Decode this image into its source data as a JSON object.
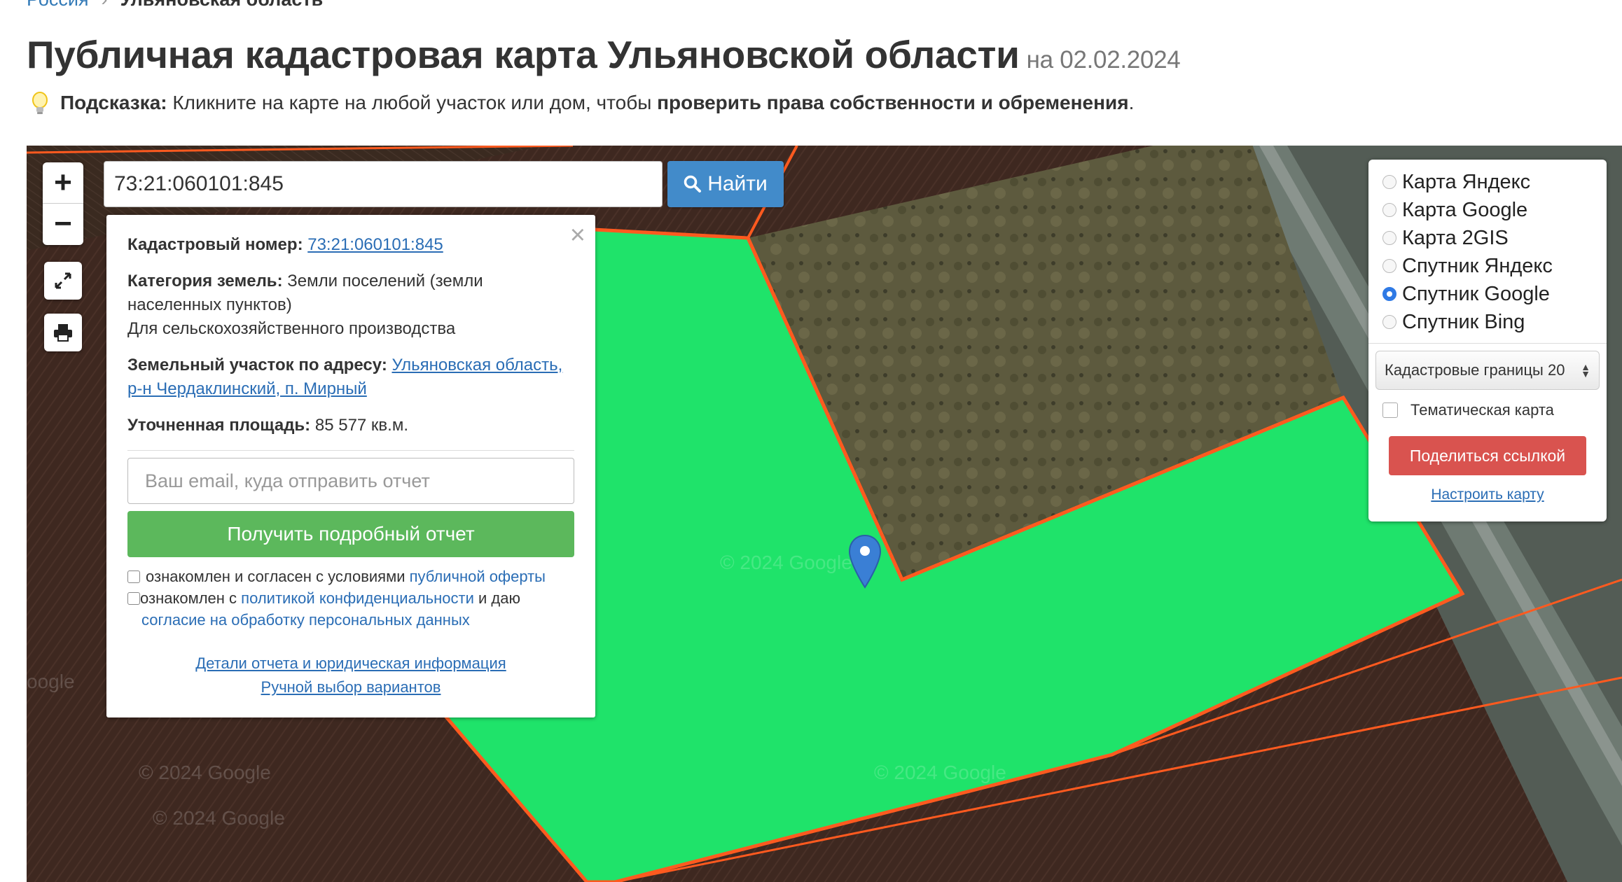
{
  "breadcrumb": {
    "parent": "Россия",
    "current": "Ульяновская область"
  },
  "title": {
    "main": "Публичная кадастровая карта Ульяновской области",
    "date": "на 02.02.2024"
  },
  "hint": {
    "icon": "lightbulb-icon",
    "label": "Подсказка:",
    "text": "Кликните на карте на любой участок или дом, чтобы",
    "emphasis": "проверить права собственности и обременения",
    "end": "."
  },
  "map": {
    "zoom_in": "+",
    "zoom_out": "−",
    "search": {
      "value": "73:21:060101:845",
      "button": "Найти"
    },
    "watermarks": [
      "© 2024 Google",
      "© 2024 Google",
      "© 2024 Google",
      "© 2024 Google",
      "oogle"
    ],
    "colors": {
      "parcel": "#1fe36a",
      "boundary": "#ff5a1f",
      "accent": "#428bca"
    }
  },
  "popup": {
    "close": "×",
    "cadastral_label": "Кадастровый номер:",
    "cadastral_value": "73:21:060101:845",
    "category_label": "Категория земель:",
    "category_value_1": "Земли поселений (земли",
    "category_value_2": "населенных пунктов)",
    "usage": "Для сельскохозяйственного производства",
    "address_label": "Земельный участок по адресу:",
    "address_value_1": "Ульяновская область,",
    "address_value_2": "р-н Чердаклинский, п. Мирный",
    "area_label": "Уточненная площадь:",
    "area_value": "85 577 кв.м.",
    "email_placeholder": "Ваш email, куда отправить отчет",
    "report_button": "Получить подробный отчет",
    "agree1_text": "ознакомлен и согласен с условиями",
    "agree1_link": "публичной оферты",
    "agree2_text": "ознакомлен с",
    "agree2_link": "политикой конфиденциальности",
    "agree2_tail": "и даю",
    "agree3_link": "согласие на обработку персональных данных",
    "link_details": "Детали отчета и юридическая информация",
    "link_manual": "Ручной выбор вариантов"
  },
  "layers": {
    "options": [
      {
        "label": "Карта Яндекс",
        "checked": false
      },
      {
        "label": "Карта Google",
        "checked": false
      },
      {
        "label": "Карта 2GIS",
        "checked": false
      },
      {
        "label": "Спутник Яндекс",
        "checked": false
      },
      {
        "label": "Спутник Google",
        "checked": true
      },
      {
        "label": "Спутник Bing",
        "checked": false
      }
    ],
    "select_value": "Кадастровые границы 20",
    "thematic_label": "Тематическая карта",
    "share_button": "Поделиться ссылкой",
    "configure_link": "Настроить карту"
  }
}
